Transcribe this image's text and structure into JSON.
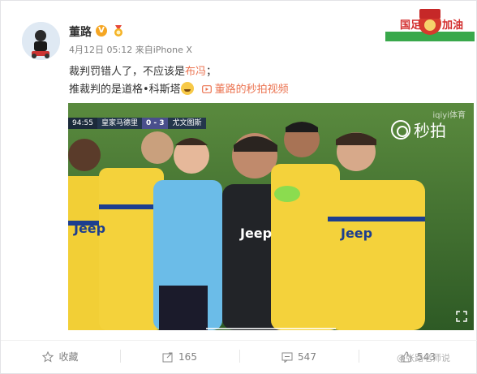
{
  "post": {
    "username": "董路",
    "verified_badge": "V",
    "timestamp": "4月12日 05:12",
    "source_prefix": "来自",
    "source": "iPhone X",
    "text_line1_a": "裁判罚错人了，不应该是",
    "text_line1_link": "布冯",
    "text_line1_b": "；",
    "text_line2": "推裁判的是道格•科斯塔",
    "video_link": "董路的秒拍视频",
    "banner_text": "国足加油"
  },
  "video": {
    "clock": "94:55",
    "home_team": "皇家马德里",
    "score": "0 - 3",
    "away_team": "尤文图斯",
    "watermark_top": "iqiyi体育",
    "watermark_main": "秒拍",
    "player_sponsor": "Jeep"
  },
  "actions": {
    "favorite_label": "收藏",
    "repost_count": "165",
    "comment_count": "547",
    "like_count": "543"
  },
  "footer": {
    "watermark": "@张路老师说"
  },
  "colors": {
    "link": "#eb7350",
    "text": "#333333",
    "meta": "#808080",
    "juventus_yellow": "#f4d23b",
    "juventus_blue": "#1c3e8f"
  }
}
